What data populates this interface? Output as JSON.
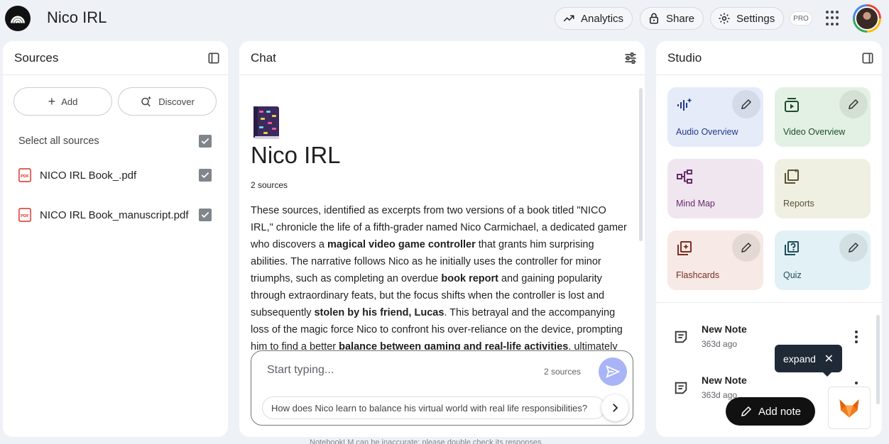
{
  "header": {
    "title": "Nico IRL",
    "analytics_label": "Analytics",
    "share_label": "Share",
    "settings_label": "Settings",
    "pro_badge": "PRO"
  },
  "sources": {
    "title": "Sources",
    "add_label": "Add",
    "discover_label": "Discover",
    "select_all_label": "Select all sources",
    "items": [
      {
        "name": "NICO IRL Book_.pdf",
        "checked": true
      },
      {
        "name": "NICO IRL Book_manuscript.pdf",
        "checked": true
      }
    ]
  },
  "chat": {
    "title": "Chat",
    "notebook_title": "Nico IRL",
    "source_count": "2 sources",
    "summary_html": "These sources, identified as excerpts from two versions of a book titled \"NICO IRL,\" chronicle the life of a fifth-grader named Nico Carmichael, a dedicated gamer who discovers a <b>magical video game controller</b> that grants him surprising abilities. The narrative follows Nico as he initially uses the controller for minor triumphs, such as completing an overdue <b>book report</b> and gaining popularity through extraordinary feats, but the focus shifts when the controller is lost and subsequently <b>stolen by his friend, Lucas</b>. This betrayal and the accompanying loss of the magic force Nico to confront his over-reliance on the device, prompting him to find a better <b>balance between gaming and real-life activities</b>, ultimately leading him to repair his",
    "input_placeholder": "Start typing...",
    "input_source_count": "2 sources",
    "suggestion": "How does Nico learn to balance his virtual world with real life responsibilities?",
    "disclaimer": "NotebookLM can be inaccurate; please double check its responses."
  },
  "studio": {
    "title": "Studio",
    "tiles": [
      {
        "label": "Audio Overview",
        "bg": "#e6ebfa",
        "fg": "#1f3a8a",
        "editable": true
      },
      {
        "label": "Video Overview",
        "bg": "#e3f1e4",
        "fg": "#1e4d2b",
        "editable": true
      },
      {
        "label": "Mind Map",
        "bg": "#efe6f0",
        "fg": "#6a2c6b",
        "editable": false
      },
      {
        "label": "Reports",
        "bg": "#efefe2",
        "fg": "#5a5330",
        "editable": false
      },
      {
        "label": "Flashcards",
        "bg": "#f6e9e6",
        "fg": "#7a2f22",
        "editable": true
      },
      {
        "label": "Quiz",
        "bg": "#e2f1f5",
        "fg": "#1f4e5e",
        "editable": true
      }
    ],
    "notes": [
      {
        "title": "New Note",
        "time": "363d ago"
      },
      {
        "title": "New Note",
        "time": "363d ago"
      }
    ],
    "tooltip_label": "expand",
    "add_note_label": "Add note"
  }
}
